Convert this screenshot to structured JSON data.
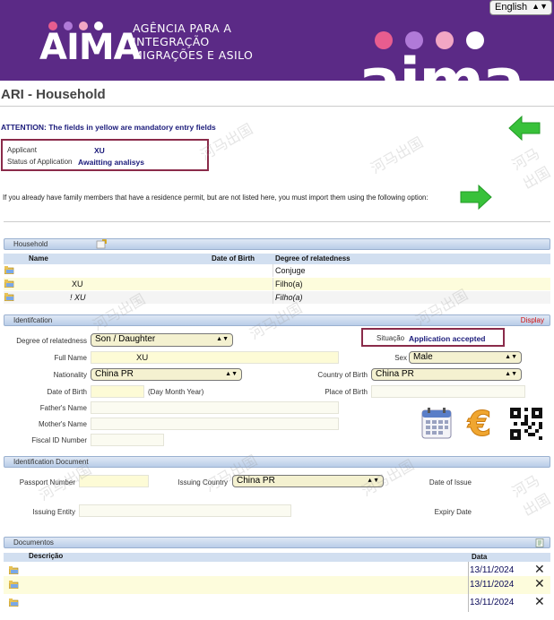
{
  "header": {
    "logo_word": "AIMA",
    "agency_lines": [
      "AGÊNCIA PARA A",
      "INTEGRAÇÃO",
      "MIGRAÇÕES E ASILO"
    ],
    "big_logo_word": "aima",
    "language": "English",
    "dot_colors": [
      "#e85d8f",
      "#b07ad8",
      "#f2a7c4",
      "#ffffff"
    ]
  },
  "page_title": "ARI - Household",
  "attention": "ATTENTION: The fields in yellow are mandatory entry fields",
  "applicant": {
    "applicant_label": "Applicant",
    "applicant_value": "XU",
    "status_label": "Status of Application",
    "status_value": "Awaitting analisys"
  },
  "import_text": "If you already have family members that have a residence permit, but are not listed here, you must import them using the following option:",
  "household": {
    "section": "Household",
    "columns": [
      "Name",
      "Date of Birth",
      "Degree of relatedness"
    ],
    "rows": [
      {
        "name": "",
        "dob": "",
        "degree": "Conjuge"
      },
      {
        "name": "XU",
        "dob": "",
        "degree": "Filho(a)"
      },
      {
        "name": "! XU",
        "dob": "",
        "degree": "Filho(a)"
      }
    ]
  },
  "identification": {
    "section": "Identifcation",
    "display_link": "Display",
    "degree_label": "Degree of relatedness",
    "degree_value": "Son / Daughter",
    "situacao_label": "Situação",
    "situacao_value": "Application accepted",
    "fullname_label": "Full Name",
    "fullname_value": "XU",
    "sex_label": "Sex",
    "sex_value": "Male",
    "nationality_label": "Nationality",
    "nationality_value": "China PR",
    "country_birth_label": "Country of Birth",
    "country_birth_value": "China PR",
    "dob_label": "Date of Birth",
    "dob_hint": "(Day Month Year)",
    "place_birth_label": "Place of Birth",
    "father_label": "Father's Name",
    "mother_label": "Mother's Name",
    "fiscal_label": "Fiscal ID Number"
  },
  "id_document": {
    "section": "Identification Document",
    "passport_label": "Passport Number",
    "issuing_country_label": "Issuing Country",
    "issuing_country_value": "China PR",
    "date_issue_label": "Date of Issue",
    "issuing_entity_label": "Issuing Entity",
    "expiry_label": "Expiry Date"
  },
  "documentos": {
    "section": "Documentos",
    "col_desc": "Descrição",
    "col_date": "Data",
    "rows": [
      {
        "date": "13/11/2024"
      },
      {
        "date": "13/11/2024"
      },
      {
        "date": "13/11/2024"
      }
    ]
  },
  "watermark_text": "河马出国"
}
